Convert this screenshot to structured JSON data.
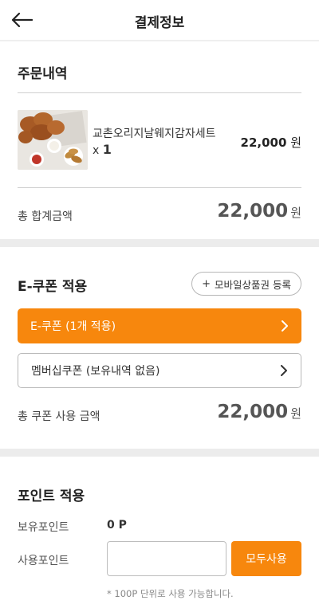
{
  "header": {
    "title": "결제정보",
    "back_icon": "arrow-left-icon"
  },
  "order": {
    "section_title": "주문내역",
    "item": {
      "name": "교촌오리지날웨지감자세트",
      "qty_prefix": "x",
      "qty": "1",
      "price": "22,000",
      "unit": "원"
    },
    "total_label": "총 합계금액",
    "total_amount": "22,000",
    "total_unit": "원"
  },
  "coupon": {
    "section_title": "E-쿠폰 적용",
    "register_label": "모바일상품권 등록",
    "ecoupon_label": "E-쿠폰 (1개 적용)",
    "membership_label": "멤버십쿠폰 (보유내역 없음)",
    "total_label": "총 쿠폰 사용 금액",
    "total_amount": "22,000",
    "total_unit": "원"
  },
  "points": {
    "section_title": "포인트 적용",
    "owned_label": "보유포인트",
    "owned_value": "0 P",
    "use_label": "사용포인트",
    "use_value": "",
    "all_use_label": "모두사용",
    "note": "* 100P 단위로 사용 가능합니다."
  },
  "colors": {
    "accent": "#f7870d",
    "divider": "#ececec"
  }
}
